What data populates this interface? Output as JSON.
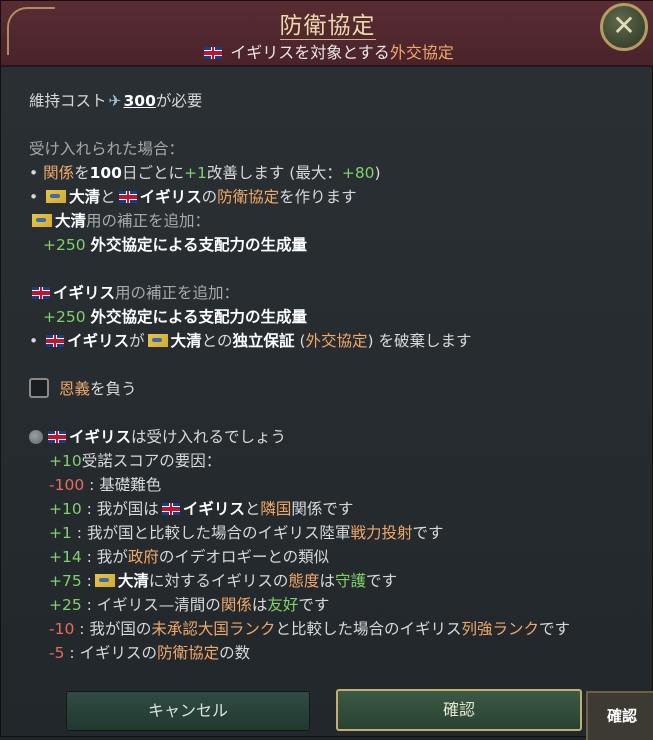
{
  "header": {
    "title": "防衛協定",
    "subtitle_country": "イギリス",
    "subtitle_mid": "を対象とする",
    "subtitle_pact": "外交協定"
  },
  "cost": {
    "prefix": "維持コスト",
    "amount": "300",
    "suffix": "が必要"
  },
  "accepted": {
    "heading": "受け入れられた場合：",
    "rel_pre": "関係",
    "rel_mid": "を",
    "rel_days": "100",
    "rel_mid2": "日ごとに",
    "rel_gain": "+1",
    "rel_mid3": "改善します (最大：",
    "rel_max": "+80",
    "rel_end": ")",
    "create_country1": "大清",
    "create_and": "と",
    "create_country2": "イギリス",
    "create_no": "の",
    "create_pact": "防衛協定",
    "create_end": "を作ります",
    "mod1_country": "大清",
    "mod1_suffix": "用の補正を追加：",
    "mod1_value": "+250",
    "mod1_text": "外交協定による支配力の生成量",
    "mod2_country": "イギリス",
    "mod2_suffix": "用の補正を追加：",
    "mod2_value": "+250",
    "mod2_text": "外交協定による支配力の生成量",
    "break_country1": "イギリス",
    "break_ga": "が",
    "break_country2": "大清",
    "break_tono": "との",
    "break_guarantee": "独立保証",
    "break_paren_open": "(",
    "break_pact": "外交協定",
    "break_end": ") を破棄します"
  },
  "obligation": {
    "word": "恩義",
    "suffix": "を負う"
  },
  "acceptance": {
    "country": "イギリス",
    "verdict": "は受け入れるでしょう",
    "score": "+10",
    "score_label": "受諾スコアの要因：",
    "factors": [
      {
        "value": "-100",
        "parts": [
          ": 基礎難色"
        ]
      },
      {
        "value": "+10",
        "parts": [
          ": 我が国は",
          "イギリス",
          "と",
          "隣国",
          "関係です"
        ]
      },
      {
        "value": "+1",
        "parts": [
          ": 我が国と比較した場合のイギリス陸軍",
          "戦力投射",
          "です"
        ]
      },
      {
        "value": "+14",
        "parts": [
          ": 我が",
          "政府",
          "のイデオロギーとの類似"
        ]
      },
      {
        "value": "+75",
        "parts": [
          ":",
          "大清",
          "に対するイギリスの",
          "態度",
          "は",
          "守護",
          "です"
        ]
      },
      {
        "value": "+25",
        "parts": [
          ": イギリス—清間の",
          "関係",
          "は",
          "友好",
          "です"
        ]
      },
      {
        "value": "-10",
        "parts": [
          ": 我が国の",
          "未承認大国ランク",
          "と比較した場合のイギリス",
          "列強ランク",
          "です"
        ]
      },
      {
        "value": "-5",
        "parts": [
          ": イギリスの",
          "防衛協定",
          "の数"
        ]
      }
    ]
  },
  "buttons": {
    "cancel": "キャンセル",
    "confirm": "確認",
    "hotkey": "確認"
  },
  "icons": {
    "close": "close-icon",
    "uk_flag": "uk-flag-icon",
    "qing_flag": "qing-flag-icon",
    "influence": "influence-icon",
    "opinion": "opinion-icon"
  },
  "colors": {
    "header": "#5a2c33",
    "positive": "#7fd26a",
    "negative": "#ec6a5a",
    "highlight": "#f0a86a",
    "gold": "#c4ad70"
  }
}
